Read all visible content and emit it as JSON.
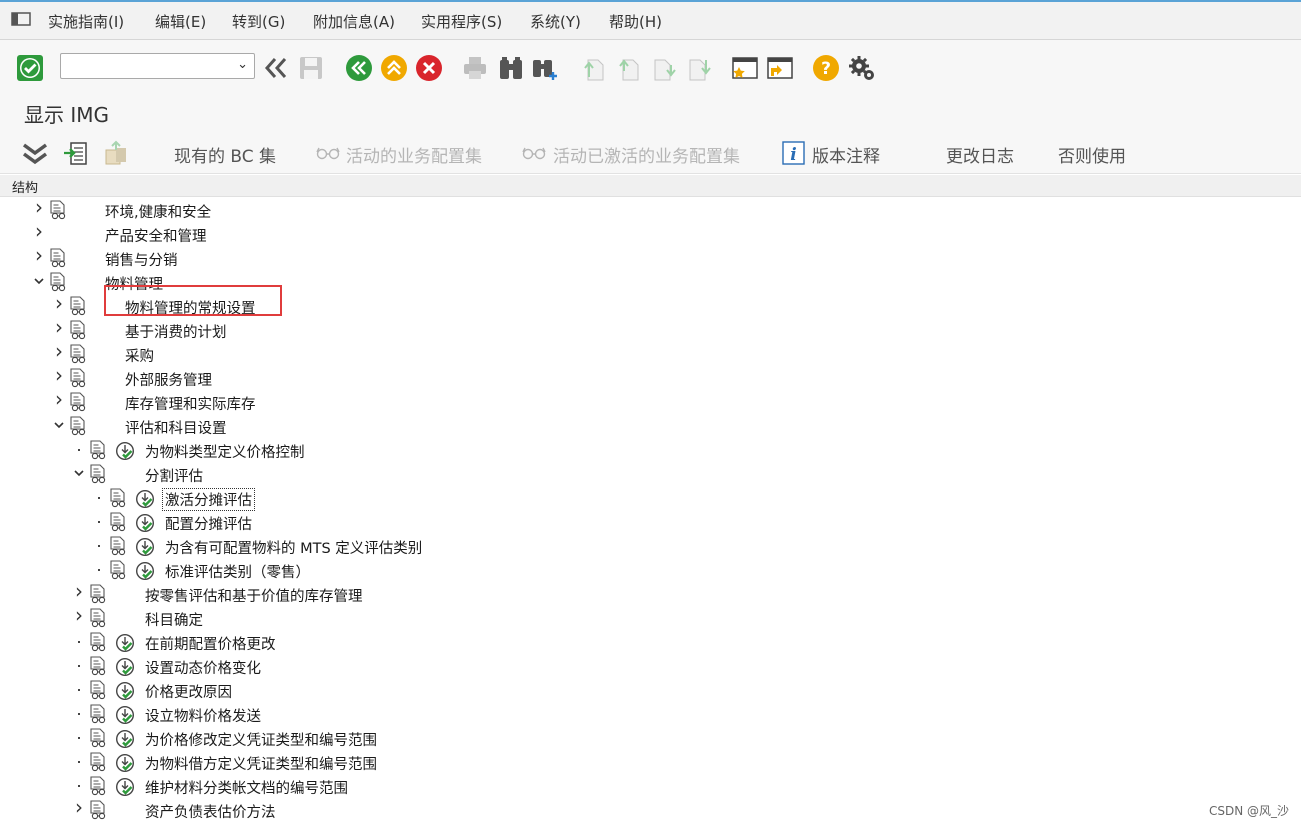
{
  "menubar": {
    "items": [
      "实施指南(I)",
      "编辑(E)",
      "转到(G)",
      "附加信息(A)",
      "实用程序(S)",
      "系统(Y)",
      "帮助(H)"
    ]
  },
  "toolbar": {
    "command_field_value": "",
    "icons": [
      "enter-check-icon",
      "back-double-icon",
      "save-icon",
      "back-icon",
      "exit-icon",
      "cancel-icon",
      "print-icon",
      "find-icon",
      "find-next-icon",
      "first-page-icon",
      "prev-page-icon",
      "next-page-icon",
      "last-page-icon",
      "new-session-icon",
      "shortcut-icon",
      "help-icon",
      "settings-icon"
    ]
  },
  "title": "显示 IMG",
  "app_toolbar": {
    "existing_bc_sets": "现有的 BC 集",
    "active_bc_sets": "活动的业务配置集",
    "activated_bc_sets": "活动已激活的业务配置集",
    "release_notes": "版本注释",
    "change_log": "更改日志",
    "deprecated": "否则使用"
  },
  "structure_header": "结构",
  "tree": [
    {
      "level": 0,
      "expander": "collapsed",
      "doc": true,
      "activity": false,
      "label": "环境,健康和安全"
    },
    {
      "level": 0,
      "expander": "collapsed",
      "doc": false,
      "activity": false,
      "label": "产品安全和管理"
    },
    {
      "level": 0,
      "expander": "collapsed",
      "doc": true,
      "activity": false,
      "label": "销售与分销"
    },
    {
      "level": 0,
      "expander": "expanded",
      "doc": true,
      "activity": false,
      "label": "物料管理"
    },
    {
      "level": 1,
      "expander": "collapsed",
      "doc": true,
      "activity": false,
      "label": "物料管理的常规设置"
    },
    {
      "level": 1,
      "expander": "collapsed",
      "doc": true,
      "activity": false,
      "label": "基于消费的计划"
    },
    {
      "level": 1,
      "expander": "collapsed",
      "doc": true,
      "activity": false,
      "label": "采购"
    },
    {
      "level": 1,
      "expander": "collapsed",
      "doc": true,
      "activity": false,
      "label": "外部服务管理"
    },
    {
      "level": 1,
      "expander": "collapsed",
      "doc": true,
      "activity": false,
      "label": "库存管理和实际库存"
    },
    {
      "level": 1,
      "expander": "expanded",
      "doc": true,
      "activity": false,
      "label": "评估和科目设置"
    },
    {
      "level": 2,
      "expander": "leaf",
      "doc": true,
      "activity": true,
      "label": "为物料类型定义价格控制"
    },
    {
      "level": 2,
      "expander": "expanded",
      "doc": true,
      "activity": false,
      "label": "分割评估"
    },
    {
      "level": 3,
      "expander": "leaf",
      "doc": true,
      "activity": true,
      "label": "激活分摊评估",
      "focused": true
    },
    {
      "level": 3,
      "expander": "leaf",
      "doc": true,
      "activity": true,
      "label": "配置分摊评估"
    },
    {
      "level": 3,
      "expander": "leaf",
      "doc": true,
      "activity": true,
      "label": "为含有可配置物料的 MTS 定义评估类别"
    },
    {
      "level": 3,
      "expander": "leaf",
      "doc": true,
      "activity": true,
      "label": "标准评估类别（零售）"
    },
    {
      "level": 2,
      "expander": "collapsed",
      "doc": true,
      "activity": false,
      "label": "按零售评估和基于价值的库存管理"
    },
    {
      "level": 2,
      "expander": "collapsed",
      "doc": true,
      "activity": false,
      "label": "科目确定"
    },
    {
      "level": 2,
      "expander": "leaf",
      "doc": true,
      "activity": true,
      "label": "在前期配置价格更改"
    },
    {
      "level": 2,
      "expander": "leaf",
      "doc": true,
      "activity": true,
      "label": "设置动态价格变化"
    },
    {
      "level": 2,
      "expander": "leaf",
      "doc": true,
      "activity": true,
      "label": "价格更改原因"
    },
    {
      "level": 2,
      "expander": "leaf",
      "doc": true,
      "activity": true,
      "label": "设立物料价格发送"
    },
    {
      "level": 2,
      "expander": "leaf",
      "doc": true,
      "activity": true,
      "label": "为价格修改定义凭证类型和编号范围"
    },
    {
      "level": 2,
      "expander": "leaf",
      "doc": true,
      "activity": true,
      "label": "为物料借方定义凭证类型和编号范围"
    },
    {
      "level": 2,
      "expander": "leaf",
      "doc": true,
      "activity": true,
      "label": "维护材料分类帐文档的编号范围"
    },
    {
      "level": 2,
      "expander": "collapsed",
      "doc": true,
      "activity": false,
      "label": "资产负债表估价方法"
    }
  ],
  "watermark": "CSDN @风_沙",
  "colors": {
    "accent_green": "#2e9a3c",
    "accent_orange": "#f0a800",
    "cancel_red": "#d9252c",
    "highlight_box": "#e03c3c"
  }
}
